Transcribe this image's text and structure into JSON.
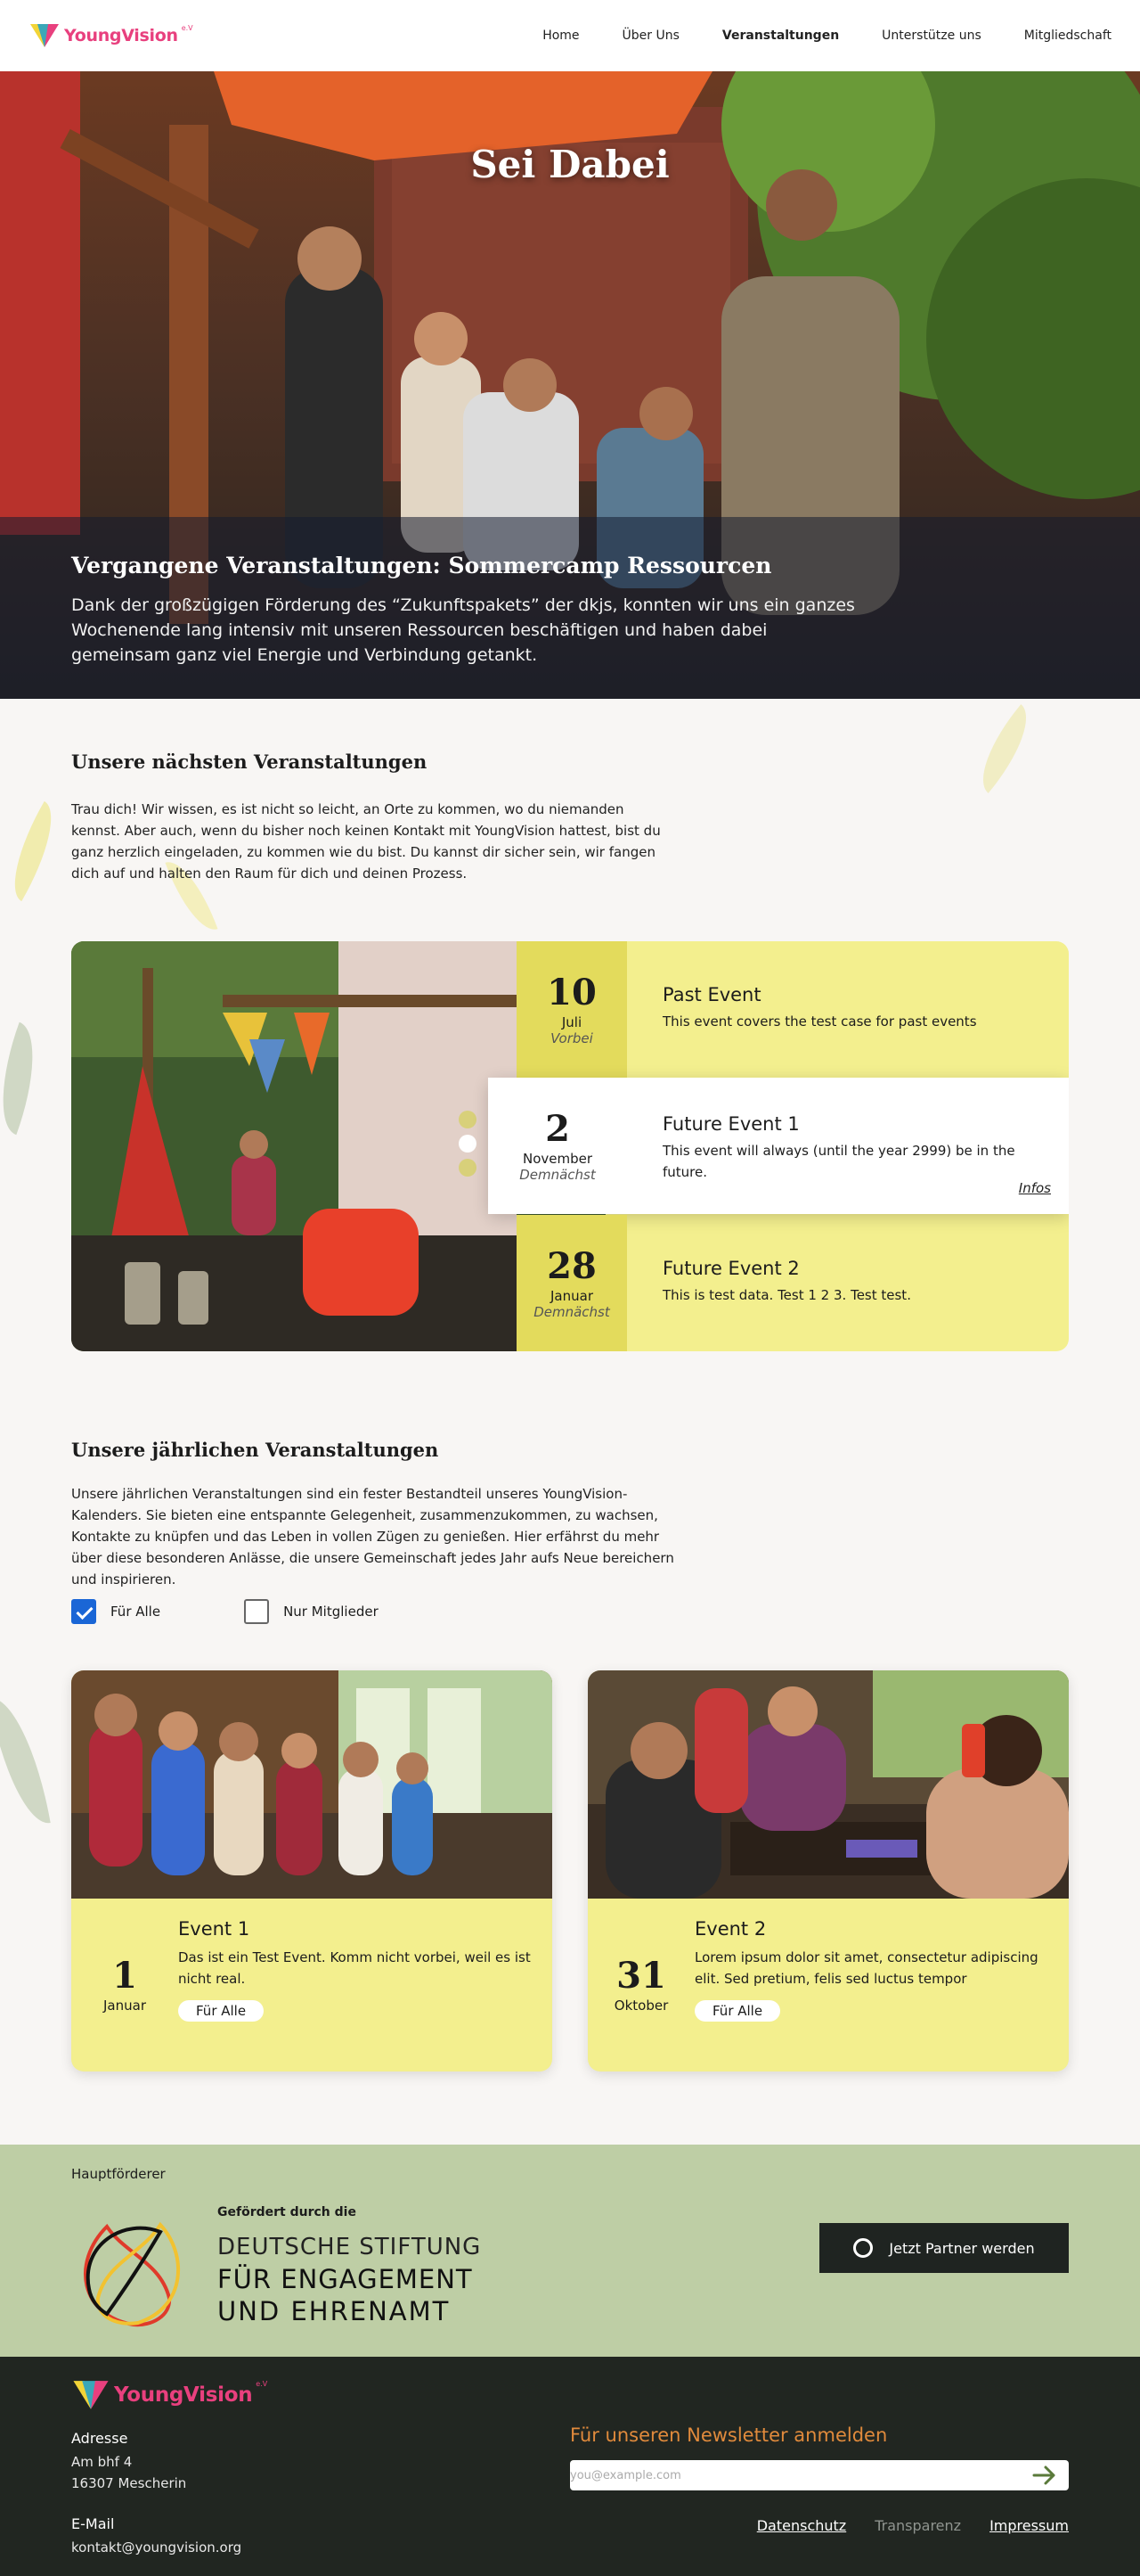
{
  "header": {
    "logo_text": "YoungVision",
    "logo_suffix": "e.V",
    "nav": [
      {
        "label": "Home",
        "active": false
      },
      {
        "label": "Über Uns",
        "active": false
      },
      {
        "label": "Veranstaltungen",
        "active": true
      },
      {
        "label": "Unterstütze uns",
        "active": false
      },
      {
        "label": "Mitgliedschaft",
        "active": false
      }
    ]
  },
  "hero": {
    "title": "Sei Dabei",
    "subtitle": "Vergangene Veranstaltungen: Sommercamp Ressourcen",
    "text": "Dank der großzügigen Förderung des “Zukunftspakets” der dkjs, konnten wir uns ein ganzes Wochenende lang intensiv mit unseren Ressourcen beschäftigen und haben dabei gemeinsam ganz viel Energie und Verbindung getankt."
  },
  "upcoming": {
    "title": "Unsere nächsten Veranstaltungen",
    "text": "Trau dich! Wir wissen, es ist nicht so leicht, an Orte zu kommen, wo du niemanden kennst. Aber auch, wenn du bisher noch keinen Kontakt mit YoungVision hattest, bist du ganz herzlich eingeladen, zu kommen wie du bist. Du kannst dir sicher sein, wir fangen dich auf und halten den Raum für dich und deinen Prozess.",
    "events": [
      {
        "day": "10",
        "month": "Juli",
        "status": "Vorbei",
        "title": "Past Event",
        "desc": "This event covers the test case for past events"
      },
      {
        "day": "2",
        "month": "November",
        "status": "Demnächst",
        "title": "Future Event 1",
        "desc": "This event will always (until the year 2999) be in the future.",
        "link": "Infos"
      },
      {
        "day": "28",
        "month": "Januar",
        "status": "Demnächst",
        "title": "Future Event 2",
        "desc": "This is test data. Test 1 2 3. Test test."
      }
    ]
  },
  "annual": {
    "title": "Unsere jährlichen Veranstaltungen",
    "text": "Unsere jährlichen Veranstaltungen sind ein fester Bestandteil unseres YoungVision-Kalenders. Sie bieten eine entspannte Gelegenheit, zusammenzukommen, zu wachsen, Kontakte zu knüpfen und das Leben in vollen Zügen zu genießen. Hier erfährst du mehr über diese besonderen Anlässe, die unsere Gemeinschaft jedes Jahr aufs Neue bereichern und inspirieren.",
    "filters": [
      {
        "label": "Für Alle",
        "checked": true
      },
      {
        "label": "Nur Mitglieder",
        "checked": false
      }
    ],
    "cards": [
      {
        "day": "1",
        "month": "Januar",
        "title": "Event 1",
        "desc": "Das ist ein Test Event. Komm nicht vorbei, weil es ist nicht real.",
        "tag": "Für Alle"
      },
      {
        "day": "31",
        "month": "Oktober",
        "title": "Event 2",
        "desc": "Lorem ipsum dolor sit amet, consectetur adipiscing elit. Sed pretium, felis sed luctus tempor",
        "tag": "Für Alle"
      }
    ]
  },
  "partner": {
    "label": "Hauptförderer",
    "funder_small": "Gefördert durch die",
    "funder_l1": "DEUTSCHE STIFTUNG",
    "funder_l2": "FÜR ENGAGEMENT",
    "funder_l3": "UND EHRENAMT",
    "button": "Jetzt Partner werden"
  },
  "footer": {
    "logo_text": "YoungVision",
    "logo_suffix": "e.V",
    "address_label": "Adresse",
    "address_line1": "Am bhf 4",
    "address_line2": "16307 Mescherin",
    "email_label": "E-Mail",
    "email": "kontakt@youngvision.org",
    "newsletter_title": "Für unseren Newsletter anmelden",
    "newsletter_placeholder": "you@example.com",
    "links": [
      {
        "label": "Datenschutz",
        "muted": false
      },
      {
        "label": "Transparenz",
        "muted": true
      },
      {
        "label": "Impressum",
        "muted": false
      }
    ]
  },
  "colors": {
    "accent_pink": "#e8407e",
    "event_yellow": "#f3ef8e",
    "partner_green": "#becea5",
    "footer_dark": "#212621",
    "newsletter_orange": "#e08a3c"
  }
}
